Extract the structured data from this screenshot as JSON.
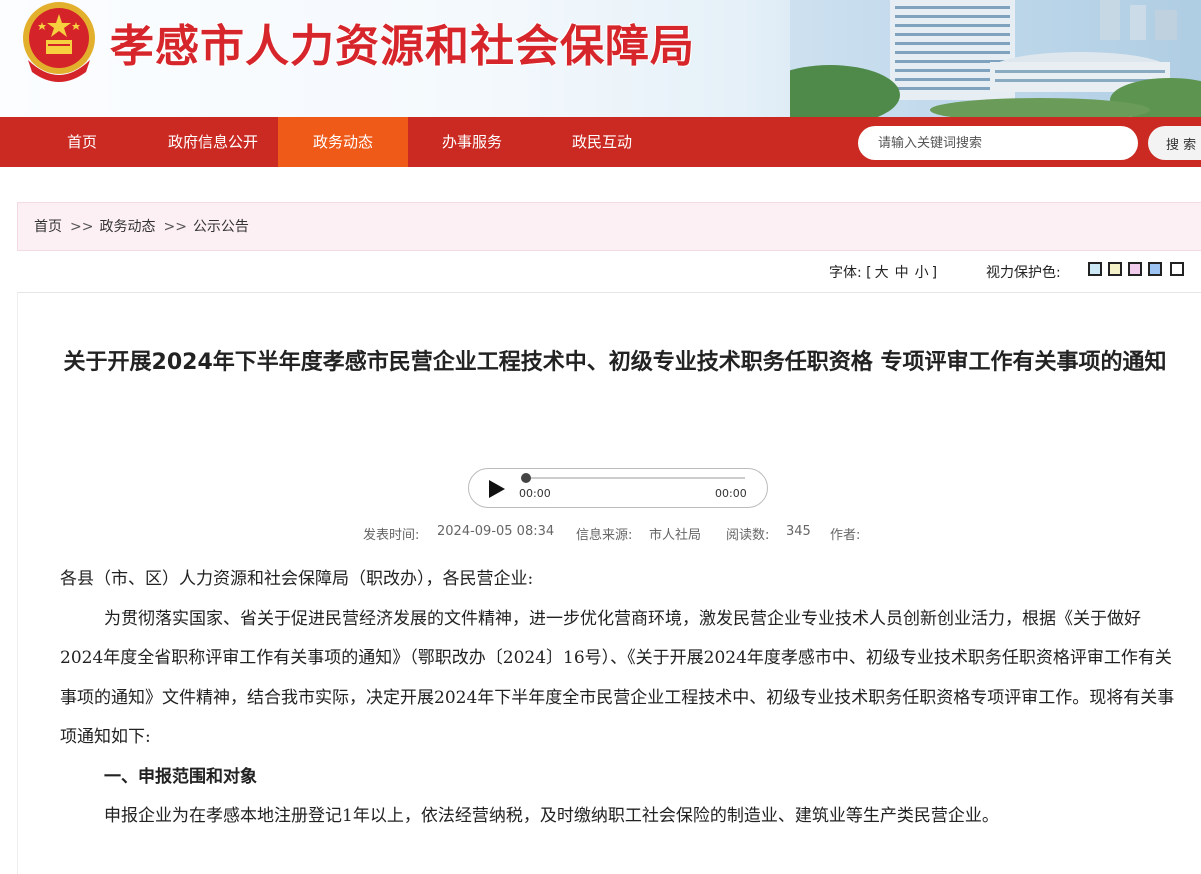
{
  "header": {
    "site_title": "孝感市人力资源和社会保障局"
  },
  "nav": {
    "items": [
      "首页",
      "政府信息公开",
      "政务动态",
      "办事服务",
      "政民互动"
    ],
    "active_index": 2,
    "search_placeholder": "请输入关键词搜索",
    "search_button": "搜 索"
  },
  "breadcrumb": [
    "首页",
    "政务动态",
    "公示公告"
  ],
  "breadcrumb_sep": ">>",
  "tools": {
    "font_label": "字体:",
    "font_open": "[",
    "font_sizes": [
      "大",
      "中",
      "小"
    ],
    "font_close": "]",
    "color_label": "视力保护色:",
    "swatches": [
      "#cce8f4",
      "#f4f1c8",
      "#f2ccec",
      "#9dc3f2",
      "#ffffff"
    ]
  },
  "article": {
    "title": "关于开展2024年下半年度孝感市民营企业工程技术中、初级专业技术职务任职资格 专项评审工作有关事项的通知",
    "player": {
      "current": "00:00",
      "total": "00:00"
    },
    "meta": {
      "time_label": "发表时间:",
      "time": "2024-09-05 08:34",
      "source_label": "信息来源:",
      "source": "市人社局",
      "views_label": "阅读数:",
      "views": "345",
      "author_label": "作者:"
    },
    "greeting": "各县（市、区）人力资源和社会保障局（职改办），各民营企业:",
    "para1": "为贯彻落实国家、省关于促进民营经济发展的文件精神，进一步优化营商环境，激发民营企业专业技术人员创新创业活力，根据《关于做好2024年度全省职称评审工作有关事项的通知》（鄂职改办〔2024〕16号）、《关于开展2024年度孝感市中、初级专业技术职务任职资格评审工作有关事项的通知》文件精神，结合我市实际，决定开展2024年下半年度全市民营企业工程技术中、初级专业技术职务任职资格专项评审工作。现将有关事项通知如下:",
    "section1": "一、申报范围和对象",
    "para2": "申报企业为在孝感本地注册登记1年以上，依法经营纳税，及时缴纳职工社会保险的制造业、建筑业等生产类民营企业。"
  }
}
